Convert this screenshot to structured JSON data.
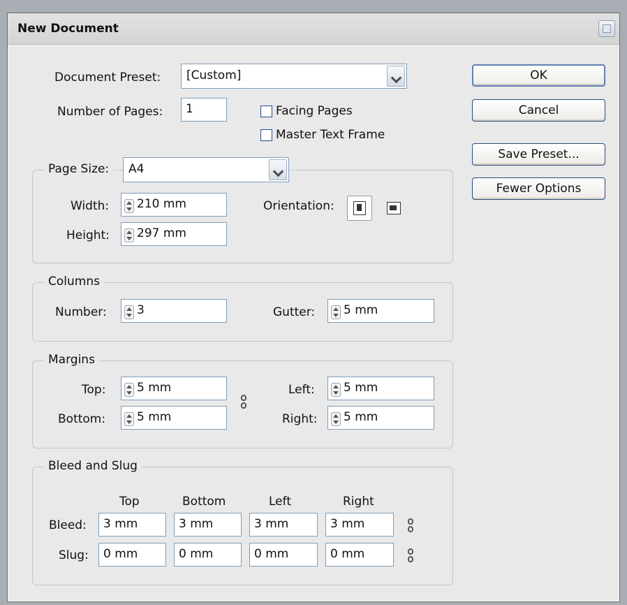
{
  "dialog": {
    "title": "New Document"
  },
  "preset": {
    "label": "Document Preset:",
    "value": "[Custom]"
  },
  "pages": {
    "label": "Number of Pages:",
    "value": "1"
  },
  "options": {
    "facing_pages": "Facing Pages",
    "master_text_frame": "Master Text Frame"
  },
  "buttons": {
    "ok": "OK",
    "cancel": "Cancel",
    "save_preset": "Save Preset...",
    "fewer_options": "Fewer Options"
  },
  "page_size": {
    "label": "Page Size:",
    "value": "A4",
    "width_label": "Width:",
    "width": "210 mm",
    "height_label": "Height:",
    "height": "297 mm",
    "orientation_label": "Orientation:"
  },
  "columns": {
    "legend": "Columns",
    "number_label": "Number:",
    "number": "3",
    "gutter_label": "Gutter:",
    "gutter": "5 mm"
  },
  "margins": {
    "legend": "Margins",
    "top_label": "Top:",
    "top": "5 mm",
    "bottom_label": "Bottom:",
    "bottom": "5 mm",
    "left_label": "Left:",
    "left": "5 mm",
    "right_label": "Right:",
    "right": "5 mm"
  },
  "bleed_slug": {
    "legend": "Bleed and Slug",
    "headers": [
      "Top",
      "Bottom",
      "Left",
      "Right"
    ],
    "bleed_label": "Bleed:",
    "bleed": [
      "3 mm",
      "3 mm",
      "3 mm",
      "3 mm"
    ],
    "slug_label": "Slug:",
    "slug": [
      "0 mm",
      "0 mm",
      "0 mm",
      "0 mm"
    ]
  },
  "icons": [
    "spinner-arrows-icon",
    "chevron-down-icon",
    "portrait-orientation-icon",
    "landscape-orientation-icon",
    "chain-link-icon",
    "window-menu-icon"
  ]
}
